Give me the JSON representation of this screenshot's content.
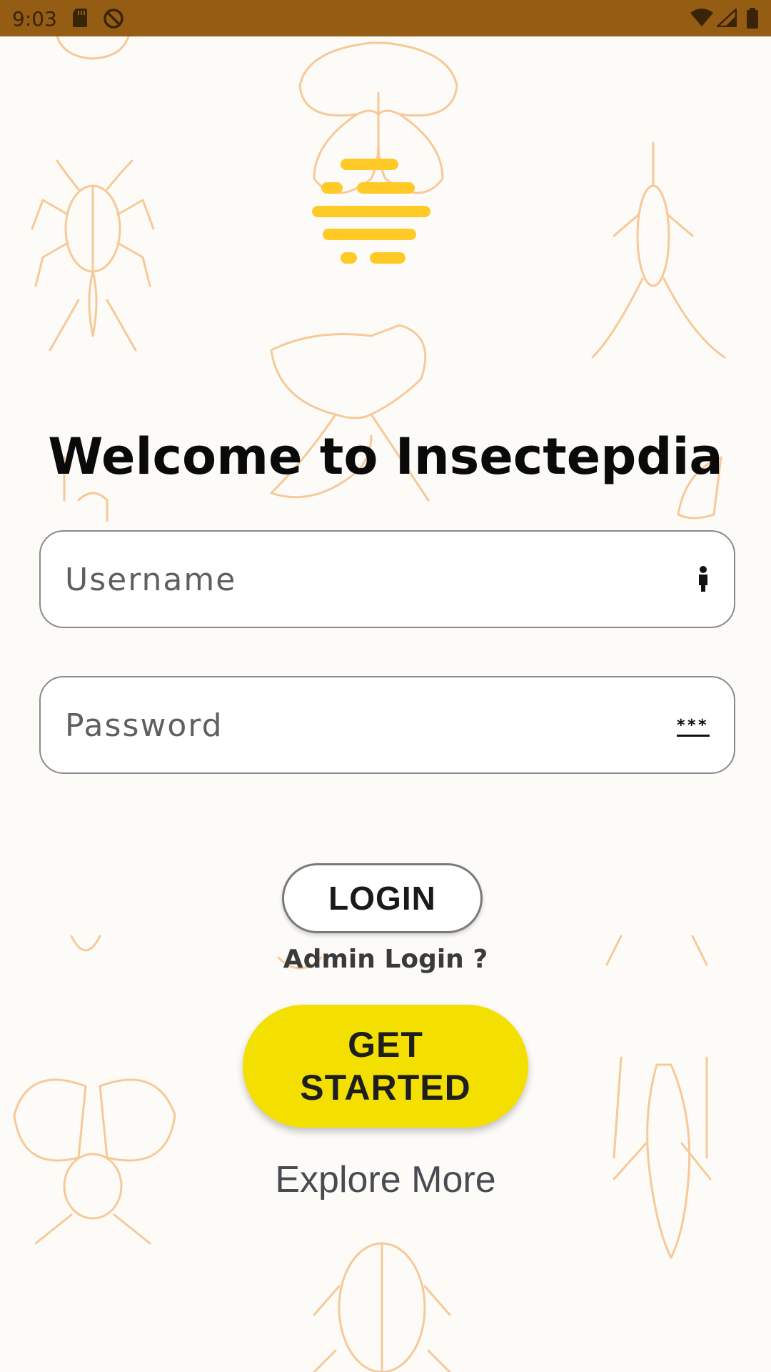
{
  "status_bar": {
    "time": "9:03",
    "left_icons": [
      "sd-card-icon",
      "do-not-disturb-icon"
    ],
    "right_icons": [
      "wifi-icon",
      "cellular-signal-icon",
      "battery-icon"
    ],
    "background_color": "#955c14"
  },
  "background": {
    "decoration_icon": "insect-outline-icon",
    "tint": "#f6c997"
  },
  "logo": {
    "icon": "app-logo-stripes-icon",
    "color": "#ffc926"
  },
  "welcome": {
    "title": "Welcome to Insectepdia"
  },
  "form": {
    "username": {
      "placeholder": "Username",
      "value": "",
      "trailing_icon": "person-icon"
    },
    "password": {
      "placeholder": "Password",
      "value": "",
      "trailing_icon": "password-icon"
    },
    "login_label": "LOGIN"
  },
  "admin_link": "Admin Login ?",
  "get_started": {
    "label": "GET STARTED",
    "color": "#f3e000"
  },
  "explore_link": "Explore More"
}
